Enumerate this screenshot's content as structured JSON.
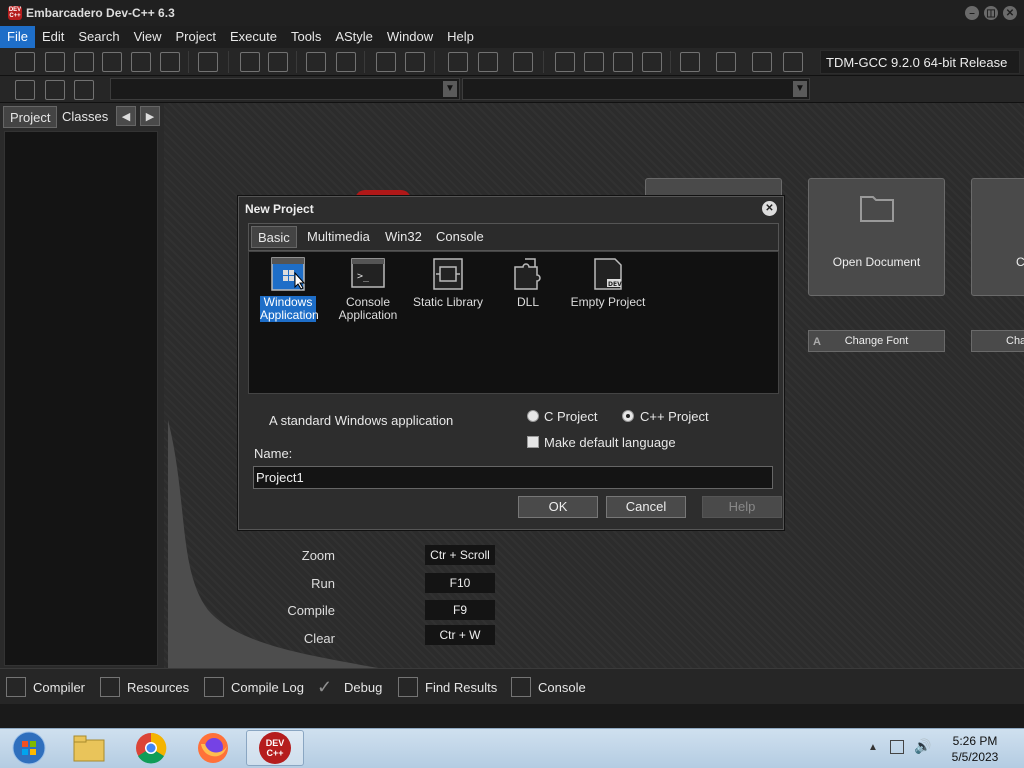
{
  "window": {
    "title": "Embarcadero Dev-C++ 6.3",
    "icon_text": "DEV C++"
  },
  "menu": [
    "File",
    "Edit",
    "Search",
    "View",
    "Project",
    "Execute",
    "Tools",
    "AStyle",
    "Window",
    "Help"
  ],
  "compiler": "TDM-GCC 9.2.0 64-bit Release",
  "left_tabs": [
    "Project",
    "Classes"
  ],
  "tiles": {
    "open_document": "Open Document",
    "change_font": "Change Font",
    "truncated_tile": "C",
    "truncated_button": "Cha"
  },
  "shortcuts": [
    {
      "label": "Zoom",
      "key": "Ctr + Scroll"
    },
    {
      "label": "Run",
      "key": "F10"
    },
    {
      "label": "Compile",
      "key": "F9"
    },
    {
      "label": "Clear",
      "key": "Ctr + W"
    }
  ],
  "dialog": {
    "title": "New Project",
    "close_glyph": "✕",
    "tabs": [
      "Basic",
      "Multimedia",
      "Win32",
      "Console"
    ],
    "active_tab": "Basic",
    "items": [
      {
        "label": "Windows Application",
        "icon": "windows-app-icon",
        "selected": true
      },
      {
        "label": "Console Application",
        "icon": "console-app-icon",
        "selected": false
      },
      {
        "label": "Static Library",
        "icon": "static-library-icon",
        "selected": false
      },
      {
        "label": "DLL",
        "icon": "dll-icon",
        "selected": false
      },
      {
        "label": "Empty Project",
        "icon": "empty-project-icon",
        "selected": false
      }
    ],
    "description": "A standard Windows application",
    "radio_c": "C Project",
    "radio_cpp": "C++ Project",
    "selected_language": "C++ Project",
    "make_default": "Make default language",
    "name_label": "Name:",
    "name_value": "Project1",
    "ok": "OK",
    "cancel": "Cancel",
    "help": "Help"
  },
  "bottom_tabs": [
    "Compiler",
    "Resources",
    "Compile Log",
    "Debug",
    "Find Results",
    "Console"
  ],
  "taskbar": {
    "time": "5:26 PM",
    "date": "5/5/2023",
    "devcpp_label": "DEV C++"
  },
  "colors": {
    "accent": "#1e6ec8",
    "background": "#1b1b1b",
    "brand": "#b51d1d"
  }
}
